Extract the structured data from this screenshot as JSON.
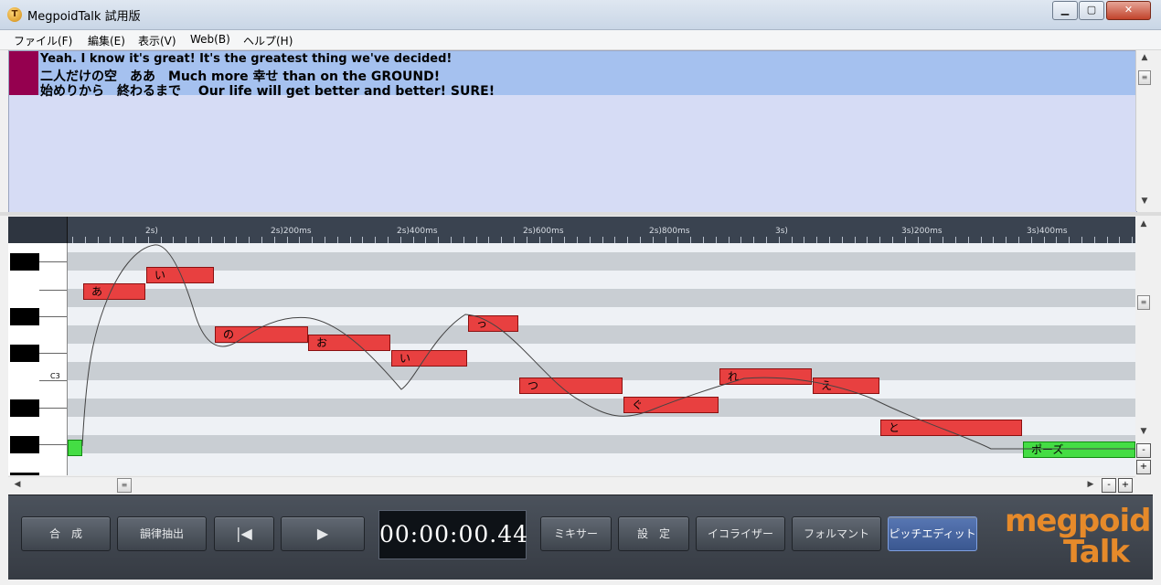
{
  "window": {
    "title": "MegpoidTalk 試用版"
  },
  "menu": [
    "ファイル(F)",
    "編集(E)",
    "表示(V)",
    "Web(B)",
    "ヘルプ(H)"
  ],
  "lyrics": [
    "Yeah. I know it's great! It's the greatest thing we've decided!",
    "二人だけの空　ああ　Much more 幸せ than on the GROUND!",
    "始めりから　終わるまで　 Our life will get better and better! SURE!"
  ],
  "ruler": [
    "2s)",
    "2s)200ms",
    "2s)400ms",
    "2s)600ms",
    "2s)800ms",
    "3s)",
    "3s)200ms",
    "3s)400ms"
  ],
  "keyboard": {
    "c3_label": "C3"
  },
  "notes": [
    "あ",
    "い",
    "の",
    "お",
    "い",
    "っ",
    "つ",
    "ぐ",
    "れ",
    "え",
    "と",
    "ポーズ"
  ],
  "controls": {
    "synthesize": "合　成",
    "prosody": "韻律抽出",
    "to_start": "|◀",
    "play": "▶",
    "time": "00:00:00.44",
    "mixer": "ミキサー",
    "settings": "設　定",
    "equalizer": "イコライザー",
    "formant": "フォルマント",
    "pitch_edit": "ピッチエディット"
  },
  "logo": {
    "line1": "megpoid",
    "line2": "Talk"
  },
  "colors": {
    "note": "#e84040",
    "pause_note": "#44dd44",
    "lyric_marker": "#95004f",
    "accent": "#e68a2a"
  }
}
